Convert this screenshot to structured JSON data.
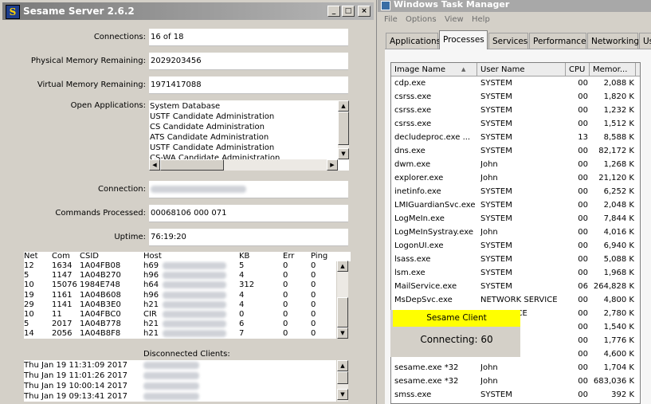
{
  "sesame": {
    "title": "Sesame Server 2.6.2",
    "window_buttons": {
      "minimize": "_",
      "maximize": "□",
      "close": "×"
    },
    "fields": {
      "connections_label": "Connections:",
      "connections_value": "16 of 18",
      "phys_mem_label": "Physical Memory Remaining:",
      "phys_mem_value": "2029203456",
      "virt_mem_label": "Virtual Memory Remaining:",
      "virt_mem_value": "1971417088",
      "open_apps_label": "Open Applications:",
      "connection_label": "Connection:",
      "commands_label": "Commands Processed:",
      "commands_value": "00068106 000 071",
      "uptime_label": "Uptime:",
      "uptime_value": "76:19:20"
    },
    "open_applications": [
      "System Database",
      "USTF Candidate Administration",
      "CS Candidate Administration",
      "ATS Candidate Administration",
      "USTF Candidate Administration",
      "CS-WA Candidate Administration"
    ],
    "clients_table": {
      "columns": [
        "Net",
        "Com",
        "CSID",
        "Host",
        "KB",
        "Err",
        "Ping"
      ],
      "rows": [
        {
          "net": "12",
          "com": "1634",
          "csid": "1A04FB08",
          "host": "h69",
          "kb": "5",
          "err": "0",
          "ping": "0"
        },
        {
          "net": "5",
          "com": "1147",
          "csid": "1A04B270",
          "host": "h96",
          "kb": "4",
          "err": "0",
          "ping": "0"
        },
        {
          "net": "10",
          "com": "15076",
          "csid": "1984E748",
          "host": "h64",
          "kb": "312",
          "err": "0",
          "ping": "0"
        },
        {
          "net": "19",
          "com": "1161",
          "csid": "1A04B608",
          "host": "h96",
          "kb": "4",
          "err": "0",
          "ping": "0"
        },
        {
          "net": "29",
          "com": "1141",
          "csid": "1A04B3E0",
          "host": "h21",
          "kb": "4",
          "err": "0",
          "ping": "0"
        },
        {
          "net": "10",
          "com": "11",
          "csid": "1A04FBC0",
          "host": "CIR",
          "kb": "0",
          "err": "0",
          "ping": "0"
        },
        {
          "net": "5",
          "com": "2017",
          "csid": "1A04B778",
          "host": "h21",
          "kb": "6",
          "err": "0",
          "ping": "0"
        },
        {
          "net": "14",
          "com": "2056",
          "csid": "1A04B8F8",
          "host": "h21",
          "kb": "7",
          "err": "0",
          "ping": "0"
        }
      ]
    },
    "disconnected_label": "Disconnected Clients:",
    "disconnected_clients": [
      "Thu Jan 19 11:31:09 2017",
      "Thu Jan 19 11:01:26 2017",
      "Thu Jan 19 10:00:14 2017",
      "Thu Jan 19 09:13:41 2017"
    ]
  },
  "task_manager": {
    "title": "Windows Task Manager",
    "menu": [
      "File",
      "Options",
      "View",
      "Help"
    ],
    "tabs": [
      "Applications",
      "Processes",
      "Services",
      "Performance",
      "Networking",
      "Us"
    ],
    "active_tab": "Processes",
    "columns": [
      "Image Name",
      "User Name",
      "CPU",
      "Memor..."
    ],
    "processes": [
      {
        "name": "cdp.exe",
        "user": "SYSTEM",
        "cpu": "00",
        "mem": "2,088 K"
      },
      {
        "name": "csrss.exe",
        "user": "SYSTEM",
        "cpu": "00",
        "mem": "1,820 K"
      },
      {
        "name": "csrss.exe",
        "user": "SYSTEM",
        "cpu": "00",
        "mem": "1,232 K"
      },
      {
        "name": "csrss.exe",
        "user": "SYSTEM",
        "cpu": "00",
        "mem": "1,512 K"
      },
      {
        "name": "decludeproc.exe ...",
        "user": "SYSTEM",
        "cpu": "13",
        "mem": "8,588 K"
      },
      {
        "name": "dns.exe",
        "user": "SYSTEM",
        "cpu": "00",
        "mem": "82,172 K"
      },
      {
        "name": "dwm.exe",
        "user": "John",
        "cpu": "00",
        "mem": "1,268 K"
      },
      {
        "name": "explorer.exe",
        "user": "John",
        "cpu": "00",
        "mem": "21,120 K"
      },
      {
        "name": "inetinfo.exe",
        "user": "SYSTEM",
        "cpu": "00",
        "mem": "6,252 K"
      },
      {
        "name": "LMIGuardianSvc.exe",
        "user": "SYSTEM",
        "cpu": "00",
        "mem": "2,048 K"
      },
      {
        "name": "LogMeIn.exe",
        "user": "SYSTEM",
        "cpu": "00",
        "mem": "7,844 K"
      },
      {
        "name": "LogMeInSystray.exe",
        "user": "John",
        "cpu": "00",
        "mem": "4,016 K"
      },
      {
        "name": "LogonUI.exe",
        "user": "SYSTEM",
        "cpu": "00",
        "mem": "6,940 K"
      },
      {
        "name": "lsass.exe",
        "user": "SYSTEM",
        "cpu": "00",
        "mem": "5,088 K"
      },
      {
        "name": "lsm.exe",
        "user": "SYSTEM",
        "cpu": "00",
        "mem": "1,968 K"
      },
      {
        "name": "MailService.exe",
        "user": "SYSTEM",
        "cpu": "06",
        "mem": "264,828 K"
      },
      {
        "name": "MsDepSvc.exe",
        "user": "NETWORK SERVICE",
        "cpu": "00",
        "mem": "4,800 K"
      },
      {
        "name": "",
        "user": "RK SERVICE",
        "cpu": "00",
        "mem": "2,780 K"
      },
      {
        "name": "",
        "user": "",
        "cpu": "00",
        "mem": "1,540 K"
      },
      {
        "name": "",
        "user": "",
        "cpu": "00",
        "mem": "1,776 K"
      },
      {
        "name": "",
        "user": "",
        "cpu": "00",
        "mem": "4,600 K"
      },
      {
        "name": "sesame.exe *32",
        "user": "John",
        "cpu": "00",
        "mem": "1,704 K"
      },
      {
        "name": "sesame.exe *32",
        "user": "John",
        "cpu": "00",
        "mem": "683,036 K"
      },
      {
        "name": "smss.exe",
        "user": "SYSTEM",
        "cpu": "00",
        "mem": "392 K"
      }
    ]
  },
  "sesame_client": {
    "title": "Sesame Client",
    "status": "Connecting: 60",
    "accent_color": "#ffff00"
  }
}
